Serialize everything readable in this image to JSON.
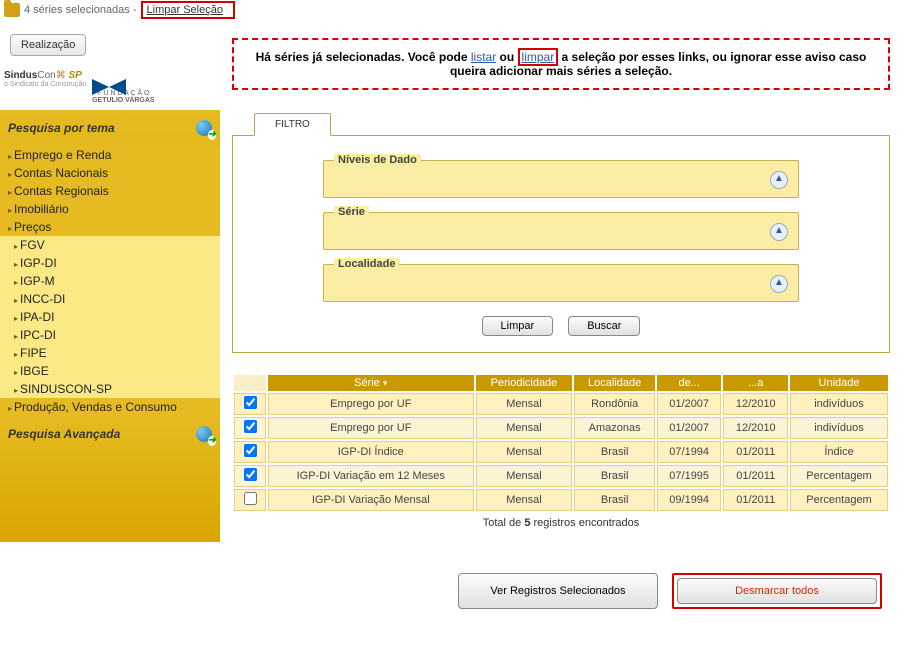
{
  "topbar": {
    "selection_text": "4 séries selecionadas -",
    "clear_link": "Limpar Seleção"
  },
  "sidebar": {
    "realizacao_btn": "Realização",
    "logo1_line1_a": "Sindus",
    "logo1_line1_b": "Con",
    "logo1_line1_c": "SP",
    "logo1_line2": "o Sindicato da Construção",
    "logo2_line1": "F U N D A Ç Ã O",
    "logo2_line2": "GETULIO VARGAS",
    "theme_title": "Pesquisa por tema",
    "menu": [
      {
        "label": "Emprego e Renda",
        "sub": false
      },
      {
        "label": "Contas Nacionais",
        "sub": false
      },
      {
        "label": "Contas Regionais",
        "sub": false
      },
      {
        "label": "Imobiliário",
        "sub": false
      },
      {
        "label": "Preços",
        "sub": false
      },
      {
        "label": "FGV",
        "sub": true
      },
      {
        "label": "IGP-DI",
        "sub": true
      },
      {
        "label": "IGP-M",
        "sub": true
      },
      {
        "label": "INCC-DI",
        "sub": true
      },
      {
        "label": "IPA-DI",
        "sub": true
      },
      {
        "label": "IPC-DI",
        "sub": true
      },
      {
        "label": "FIPE",
        "sub": true
      },
      {
        "label": "IBGE",
        "sub": true
      },
      {
        "label": "SINDUSCON-SP",
        "sub": true
      },
      {
        "label": "Produção, Vendas e Consumo",
        "sub": false
      }
    ],
    "advanced": "Pesquisa Avançada"
  },
  "alert": {
    "part1": "Há séries já selecionadas. Você pode ",
    "listar": "listar",
    "part2": " ou ",
    "limpar": "limpar",
    "part3": " a seleção por esses links, ou ignorar esse aviso caso queira adicionar mais séries a seleção."
  },
  "tab_label": "FILTRO",
  "filters": {
    "niveis": "Níveis de Dado",
    "serie": "Série",
    "localidade": "Localidade"
  },
  "buttons": {
    "limpar": "Limpar",
    "buscar": "Buscar",
    "ver_sel": "Ver Registros Selecionados",
    "desmarcar": "Desmarcar todos"
  },
  "grid": {
    "headers": {
      "serie": "Série",
      "period": "Periodicidade",
      "local": "Localidade",
      "de": "de...",
      "a": "...a",
      "unidade": "Unidade"
    },
    "rows": [
      {
        "checked": true,
        "serie": "Emprego por UF",
        "period": "Mensal",
        "local": "Rondônia",
        "de": "01/2007",
        "a": "12/2010",
        "unidade": "indivíduos"
      },
      {
        "checked": true,
        "serie": "Emprego por UF",
        "period": "Mensal",
        "local": "Amazonas",
        "de": "01/2007",
        "a": "12/2010",
        "unidade": "indivíduos"
      },
      {
        "checked": true,
        "serie": "IGP-DI Índice",
        "period": "Mensal",
        "local": "Brasil",
        "de": "07/1994",
        "a": "01/2011",
        "unidade": "Índice"
      },
      {
        "checked": true,
        "serie": "IGP-DI Variação em 12 Meses",
        "period": "Mensal",
        "local": "Brasil",
        "de": "07/1995",
        "a": "01/2011",
        "unidade": "Percentagem"
      },
      {
        "checked": false,
        "serie": "IGP-DI Variação Mensal",
        "period": "Mensal",
        "local": "Brasil",
        "de": "09/1994",
        "a": "01/2011",
        "unidade": "Percentagem"
      }
    ],
    "total_a": "Total de ",
    "total_n": "5",
    "total_b": " registros encontrados"
  }
}
